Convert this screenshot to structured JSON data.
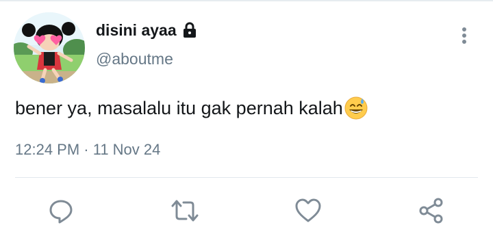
{
  "user": {
    "display_name": "disini ayaa",
    "handle": "@aboutme",
    "avatar": "avatar-cartoon-girl",
    "lock_icon": "lock-icon"
  },
  "tweet": {
    "text": "bener ya, masalalu itu gak pernah kalah",
    "emoji": "grinning-face-with-sweat",
    "timestamp": "12:24 PM · 11 Nov 24"
  },
  "actions": [
    {
      "name": "reply",
      "icon": "comment-icon"
    },
    {
      "name": "retweet",
      "icon": "retweet-icon"
    },
    {
      "name": "like",
      "icon": "heart-icon"
    },
    {
      "name": "share",
      "icon": "share-icon"
    }
  ],
  "colors": {
    "text": "#14171a",
    "secondary": "#657786",
    "icon": "#7f8b96",
    "divider": "#e1e8ed"
  }
}
